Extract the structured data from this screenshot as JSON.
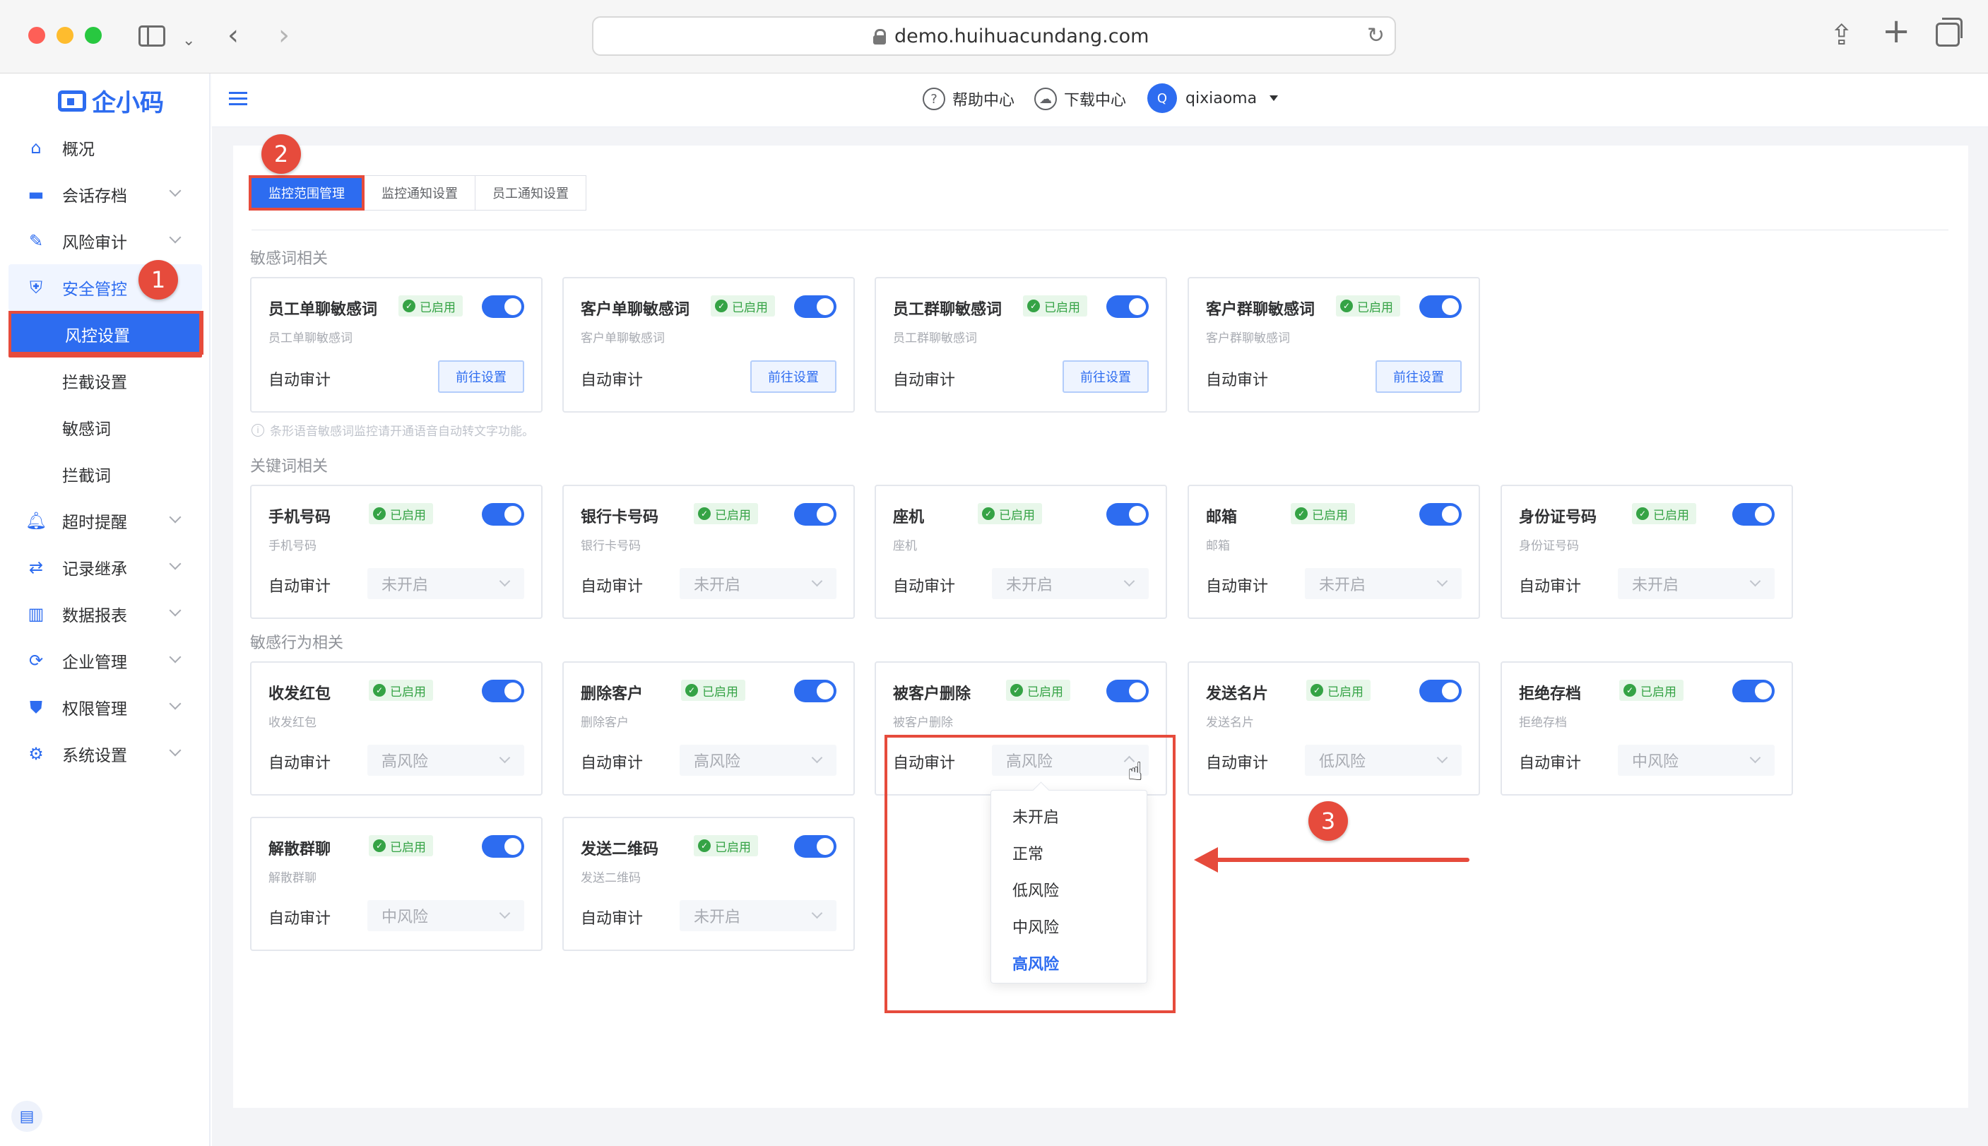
{
  "browser": {
    "url": "demo.huihuacundang.com"
  },
  "brand": {
    "logo_text": "企小码",
    "accent": "#2d6cf0",
    "annotation_red": "#e64b3c",
    "enabled_green": "#35a345"
  },
  "sidebar": {
    "items": [
      {
        "label": "概况",
        "icon": "home-icon",
        "has_arrow": false
      },
      {
        "label": "会话存档",
        "icon": "folder-icon",
        "has_arrow": true
      },
      {
        "label": "风险审计",
        "icon": "edit-icon",
        "has_arrow": true
      },
      {
        "label": "安全管控",
        "icon": "shield-icon",
        "has_arrow": false
      }
    ],
    "sub_items": [
      "风控设置",
      "拦截设置",
      "敏感词",
      "拦截词"
    ],
    "items_after": [
      {
        "label": "超时提醒",
        "icon": "bell-icon"
      },
      {
        "label": "记录继承",
        "icon": "user-transfer-icon"
      },
      {
        "label": "数据报表",
        "icon": "bar-chart-icon"
      },
      {
        "label": "企业管理",
        "icon": "refresh-icon"
      },
      {
        "label": "权限管理",
        "icon": "key-shield-icon"
      },
      {
        "label": "系统设置",
        "icon": "gear-icon"
      }
    ]
  },
  "header": {
    "help": "帮助中心",
    "download": "下载中心",
    "avatar_letter": "Q",
    "username": "qixiaoma"
  },
  "tabs": [
    "监控范围管理",
    "监控通知设置",
    "员工通知设置"
  ],
  "sections": {
    "sensitive_words": "敏感词相关",
    "keywords": "关键词相关",
    "behaviors": "敏感行为相关"
  },
  "common": {
    "enabled": "已启用",
    "auto_audit": "自动审计",
    "goto": "前往设置"
  },
  "hint": "条形语音敏感词监控请开通语音自动转文字功能。",
  "sensitive_cards": [
    {
      "title": "员工单聊敏感词",
      "sub": "员工单聊敏感词"
    },
    {
      "title": "客户单聊敏感词",
      "sub": "客户单聊敏感词"
    },
    {
      "title": "员工群聊敏感词",
      "sub": "员工群聊敏感词"
    },
    {
      "title": "客户群聊敏感词",
      "sub": "客户群聊敏感词"
    }
  ],
  "keyword_cards": [
    {
      "title": "手机号码",
      "sub": "手机号码",
      "value": "未开启"
    },
    {
      "title": "银行卡号码",
      "sub": "银行卡号码",
      "value": "未开启"
    },
    {
      "title": "座机",
      "sub": "座机",
      "value": "未开启"
    },
    {
      "title": "邮箱",
      "sub": "邮箱",
      "value": "未开启"
    },
    {
      "title": "身份证号码",
      "sub": "身份证号码",
      "value": "未开启"
    }
  ],
  "behavior_cards": [
    {
      "title": "收发红包",
      "sub": "收发红包",
      "value": "高风险"
    },
    {
      "title": "删除客户",
      "sub": "删除客户",
      "value": "高风险"
    },
    {
      "title": "被客户删除",
      "sub": "被客户删除",
      "value": "高风险"
    },
    {
      "title": "发送名片",
      "sub": "发送名片",
      "value": "低风险"
    },
    {
      "title": "拒绝存档",
      "sub": "拒绝存档",
      "value": "中风险"
    },
    {
      "title": "解散群聊",
      "sub": "解散群聊",
      "value": "中风险"
    },
    {
      "title": "发送二维码",
      "sub": "发送二维码",
      "value": "未开启"
    }
  ],
  "dropdown": {
    "options": [
      "未开启",
      "正常",
      "低风险",
      "中风险",
      "高风险"
    ],
    "selected": "高风险"
  },
  "annotations": [
    "1",
    "2",
    "3"
  ]
}
